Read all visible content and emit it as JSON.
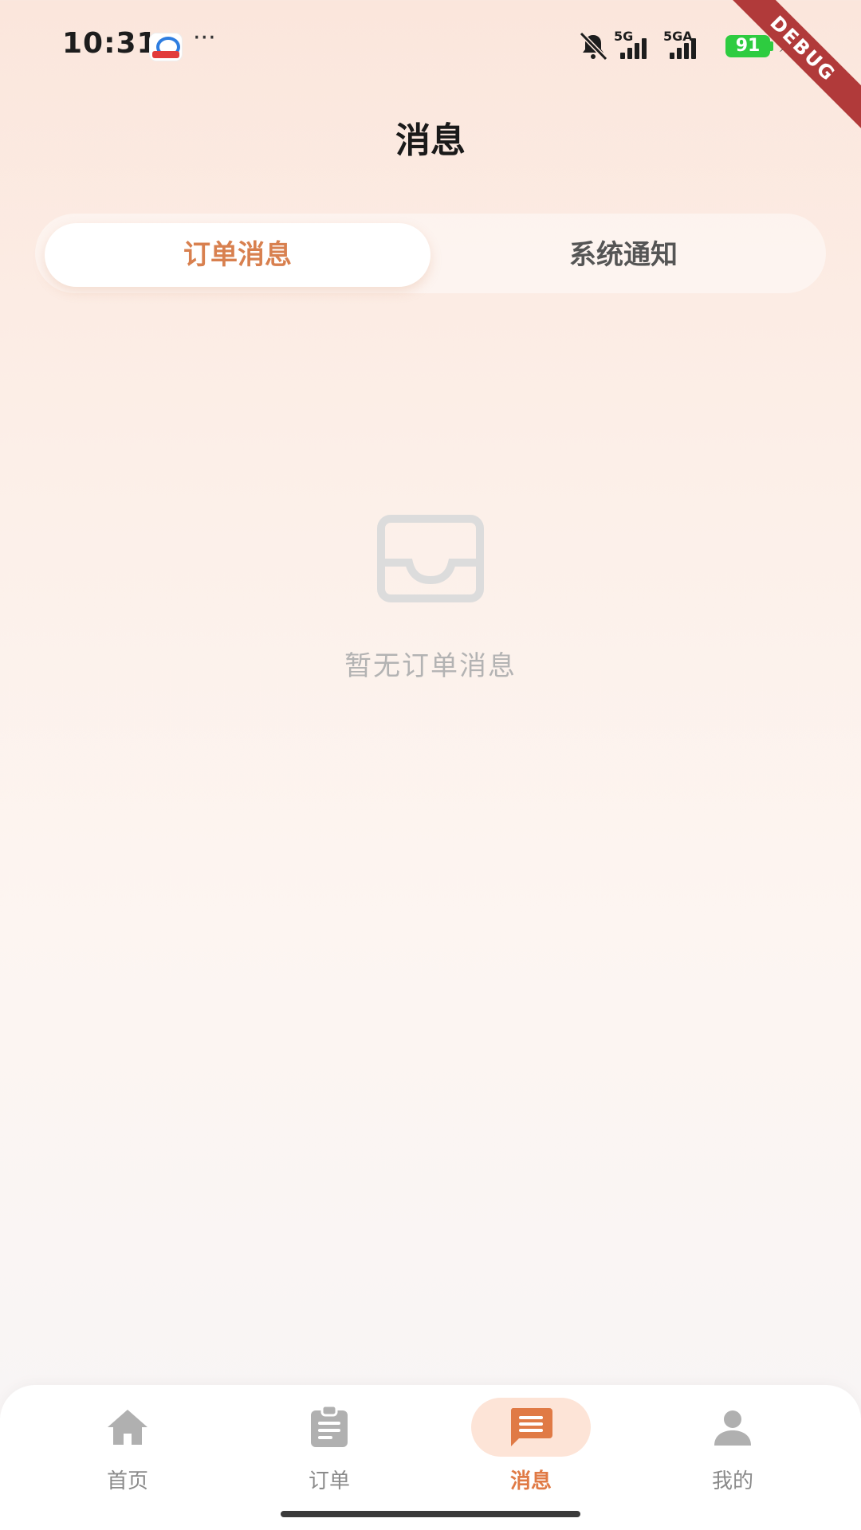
{
  "status_bar": {
    "time": "10:31",
    "more": "···",
    "network_1": "5G",
    "network_2": "5GA",
    "battery": "91",
    "battery_color": "#2ecc40",
    "debug_label": "DEBUG"
  },
  "header": {
    "title": "消息"
  },
  "tabs": [
    {
      "label": "订单消息",
      "active": true
    },
    {
      "label": "系统通知",
      "active": false
    }
  ],
  "empty_state": {
    "icon": "inbox-icon",
    "text": "暂无订单消息"
  },
  "bottom_nav": [
    {
      "label": "首页",
      "icon": "home-icon",
      "active": false
    },
    {
      "label": "订单",
      "icon": "clipboard-icon",
      "active": false
    },
    {
      "label": "消息",
      "icon": "message-icon",
      "active": true
    },
    {
      "label": "我的",
      "icon": "person-icon",
      "active": false
    }
  ],
  "colors": {
    "accent": "#e07a45",
    "inactive": "#8a8a8a",
    "icon_inactive": "#b0b0b0"
  }
}
